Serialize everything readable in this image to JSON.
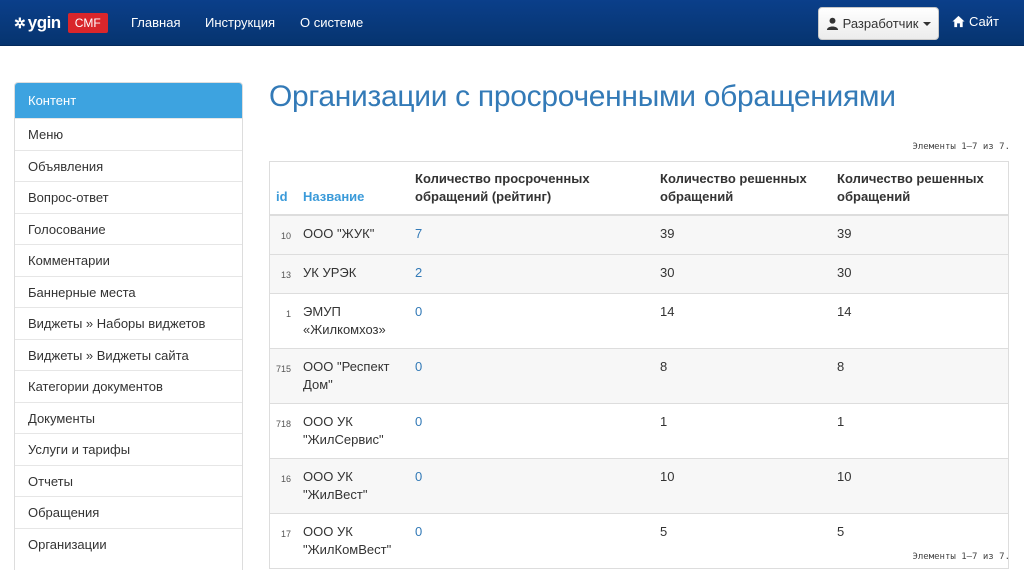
{
  "navbar": {
    "brand_text": "ygin",
    "brand_badge": "CMF",
    "links": [
      "Главная",
      "Инструкция",
      "О системе"
    ],
    "user_button": "Разработчик",
    "site_link": "Сайт",
    "icons": {
      "brand": "gear-icon",
      "user": "user-icon",
      "site": "home-icon"
    }
  },
  "sidebar": {
    "items": [
      {
        "label": "Контент",
        "active": true
      },
      {
        "label": "Меню"
      },
      {
        "label": "Объявления"
      },
      {
        "label": "Вопрос-ответ"
      },
      {
        "label": "Голосование"
      },
      {
        "label": "Комментарии"
      },
      {
        "label": "Баннерные места"
      },
      {
        "label": "Виджеты » Наборы виджетов"
      },
      {
        "label": "Виджеты » Виджеты сайта"
      },
      {
        "label": "Категории документов"
      },
      {
        "label": "Документы"
      },
      {
        "label": "Услуги и тарифы"
      },
      {
        "label": "Отчеты"
      },
      {
        "label": "Обращения"
      },
      {
        "label": "Организации"
      }
    ]
  },
  "main": {
    "title": "Организации с просроченными обращениями",
    "summary_top": "Элементы 1—7 из 7.",
    "summary_bottom": "Элементы 1—7 из 7."
  },
  "table": {
    "headers": {
      "id": "id",
      "name": "Название",
      "rating": "Количество просроченных обращений (рейтинг)",
      "solved1": "Количество решенных обращений",
      "solved2": "Количество решенных обращений"
    },
    "rows": [
      {
        "id": "10",
        "name": "ООО \"ЖУК\"",
        "rating": "7",
        "solved1": "39",
        "solved2": "39"
      },
      {
        "id": "13",
        "name": "УК УРЭК",
        "rating": "2",
        "solved1": "30",
        "solved2": "30"
      },
      {
        "id": "1",
        "name": "ЭМУП «Жилкомхоз»",
        "rating": "0",
        "solved1": "14",
        "solved2": "14"
      },
      {
        "id": "715",
        "name": "ООО \"Респект Дом\"",
        "rating": "0",
        "solved1": "8",
        "solved2": "8"
      },
      {
        "id": "718",
        "name": "ООО УК \"ЖилСервис\"",
        "rating": "0",
        "solved1": "1",
        "solved2": "1"
      },
      {
        "id": "16",
        "name": "ООО УК \"ЖилВест\"",
        "rating": "0",
        "solved1": "10",
        "solved2": "10"
      },
      {
        "id": "17",
        "name": "ООО УК \"ЖилКомВест\"",
        "rating": "0",
        "solved1": "5",
        "solved2": "5"
      }
    ]
  },
  "colors": {
    "navbar": "#06346f",
    "accent": "#3da3e0",
    "link": "#337ab7",
    "badge": "#d9262b"
  }
}
